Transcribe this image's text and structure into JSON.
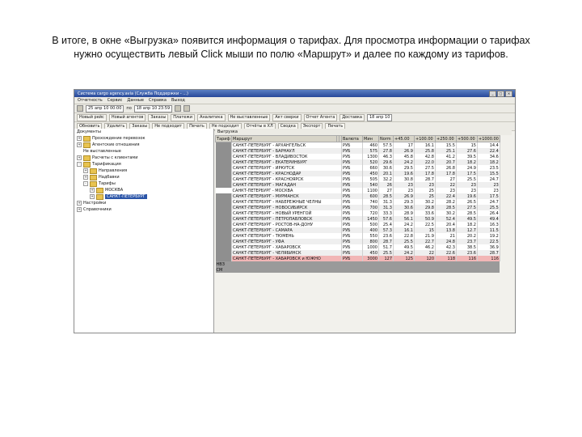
{
  "caption": {
    "line1": "В итоге, в окне «Выгрузка» появится информация о тарифах. Для просмотра информации о тарифах",
    "line2": "нужно осуществить левый Click мыши по полю «Маршрут» и далее по каждому из тарифов."
  },
  "window": {
    "title": "Система cargo agency.avia (Служба Поддержки - ...)",
    "minimize": "_",
    "maximize": "□",
    "close": "×"
  },
  "menu": [
    "Отчетность",
    "Сервис",
    "Данные",
    "Справка",
    "Выход"
  ],
  "toolbar1": {
    "date_from": "25 апр 10 00:00",
    "to_label": "по",
    "date_to": "18 апр 10 23:59"
  },
  "toolbar2": [
    "Новый рейс",
    "Новый агентов",
    "Заказы",
    "Платежи",
    "Аналитика",
    "Не выставленные",
    "Акт сверки",
    "Отчет Агента",
    "Доставка",
    "18 апр 10"
  ],
  "toolbar3": [
    "Обновить",
    "Удалить",
    "Заказы",
    "Не подходит",
    "Печать",
    "Не подходит",
    "Отчёты в ХЛ",
    "Сводка",
    "Экспорт",
    "Печать"
  ],
  "tree": {
    "items": [
      {
        "label": "Документы",
        "level": 0,
        "folder": false,
        "expander": ""
      },
      {
        "label": "Прохождение перевозок",
        "level": 0,
        "folder": true,
        "expander": "+"
      },
      {
        "label": "Агентские отношения",
        "level": 0,
        "folder": true,
        "expander": "+"
      },
      {
        "label": "Не выставленные",
        "level": 1,
        "folder": false,
        "expander": ""
      },
      {
        "label": "Расчеты с клиентами",
        "level": 0,
        "folder": true,
        "expander": "+"
      },
      {
        "label": "Тарификация",
        "level": 0,
        "folder": true,
        "expander": "-"
      },
      {
        "label": "Направления",
        "level": 1,
        "folder": true,
        "expander": "+"
      },
      {
        "label": "Надбавки",
        "level": 1,
        "folder": true,
        "expander": "+"
      },
      {
        "label": "Тарифы",
        "level": 1,
        "folder": true,
        "expander": "-"
      },
      {
        "label": "МОСКВА",
        "level": 2,
        "folder": true,
        "expander": "+"
      },
      {
        "label": "САНКТ-ПЕТЕРБУРГ",
        "level": 2,
        "folder": true,
        "expander": "+",
        "selected": true
      },
      {
        "label": "Настройки",
        "level": 0,
        "folder": false,
        "expander": "+"
      },
      {
        "label": "Справочники",
        "level": 0,
        "folder": false,
        "expander": "+"
      }
    ]
  },
  "grid": {
    "title": "Выгрузка",
    "columns": [
      "Тариф",
      "Маршрут",
      "",
      "",
      "Валюта",
      "Мин",
      "Norm",
      "+45.00",
      "+100.00",
      "+250.00",
      "+500.00",
      "+1000.00"
    ],
    "rowhead_label": "ВЭЯ",
    "rows": [
      [
        "САНКТ-ПЕТЕРБУРГ - АРХАНГЕЛЬСК",
        "РУБ",
        "460",
        "57.5",
        "17",
        "16.1",
        "15.5",
        "15",
        "14.4"
      ],
      [
        "САНКТ-ПЕТЕРБУРГ - БАРНАУЛ",
        "РУБ",
        "575",
        "27.8",
        "26.9",
        "25.8",
        "25.1",
        "27.6",
        "22.4"
      ],
      [
        "САНКТ-ПЕТЕРБУРГ - ВЛАДИВОСТОК",
        "РУБ",
        "1300",
        "46.3",
        "45.8",
        "42.8",
        "41.2",
        "39.5",
        "34.6"
      ],
      [
        "САНКТ-ПЕТЕРБУРГ - ЕКАТЕРИНБУРГ",
        "РУБ",
        "520",
        "29.6",
        "24.2",
        "22.0",
        "20.7",
        "18.2",
        "18.2"
      ],
      [
        "САНКТ-ПЕТЕРБУРГ - ИРКУТСК",
        "РУБ",
        "660",
        "30.6",
        "29.5",
        "27.5",
        "26.8",
        "24.9",
        "23.5"
      ],
      [
        "САНКТ-ПЕТЕРБУРГ - КРАСНОДАР",
        "РУБ",
        "450",
        "20.1",
        "19.6",
        "17.8",
        "17.8",
        "17.5",
        "15.5"
      ],
      [
        "САНКТ-ПЕТЕРБУРГ - КРАСНОЯРСК",
        "РУБ",
        "505",
        "32.2",
        "30.8",
        "28.7",
        "27",
        "25.5",
        "24.7"
      ],
      [
        "САНКТ-ПЕТЕРБУРГ - МАГАДАН",
        "РУБ",
        "540",
        "26",
        "23",
        "23",
        "22",
        "23",
        "23"
      ],
      [
        "САНКТ-ПЕТЕРБУРГ - МОСКВА",
        "РУБ",
        "1100",
        "27",
        "23",
        "25",
        "23",
        "23",
        "23"
      ],
      [
        "САНКТ-ПЕТЕРБУРГ - МУРМАНСК",
        "РУБ",
        "600",
        "28.5",
        "26.9",
        "25",
        "22.4",
        "19.6",
        "17.5"
      ],
      [
        "САНКТ-ПЕТЕРБУРГ - НАБЕРЕЖНЫЕ ЧЕЛНЫ",
        "РУБ",
        "740",
        "31.3",
        "29.3",
        "30.2",
        "28.2",
        "26.5",
        "24.7"
      ],
      [
        "САНКТ-ПЕТЕРБУРГ - НОВОСИБИРСК",
        "РУБ",
        "700",
        "31.3",
        "30.6",
        "29.8",
        "28.5",
        "27.5",
        "25.5"
      ],
      [
        "САНКТ-ПЕТЕРБУРГ - НОВЫЙ УРЕНГОЙ",
        "РУБ",
        "720",
        "33.3",
        "28.9",
        "33.6",
        "30.2",
        "28.5",
        "26.4"
      ],
      [
        "САНКТ-ПЕТЕРБУРГ - ПЕТРОПАВЛОВСК",
        "РУБ",
        "1450",
        "57.6",
        "56.1",
        "50.9",
        "52.4",
        "49.5",
        "49.4"
      ],
      [
        "САНКТ-ПЕТЕРБУРГ - РОСТОВ-НА-ДОНУ",
        "РУБ",
        "500",
        "25.4",
        "24.2",
        "22.5",
        "20.4",
        "18.2",
        "16.3"
      ],
      [
        "САНКТ-ПЕТЕРБУРГ - САМАРА",
        "РУБ",
        "400",
        "57.3",
        "16.1",
        "15",
        "13.8",
        "12.7",
        "11.5"
      ],
      [
        "САНКТ-ПЕТЕРБУРГ - ТЮМЕНЬ",
        "РУБ",
        "550",
        "23.6",
        "22.8",
        "21.9",
        "21",
        "20.2",
        "19.2"
      ],
      [
        "САНКТ-ПЕТЕРБУРГ - УФА",
        "РУБ",
        "800",
        "28.7",
        "25.5",
        "22.7",
        "24.8",
        "23.7",
        "22.5"
      ],
      [
        "САНКТ-ПЕТЕРБУРГ - ХАБАРОВСК",
        "РУБ",
        "1000",
        "51.7",
        "49.5",
        "46.2",
        "42.3",
        "38.5",
        "36.9"
      ],
      [
        "САНКТ-ПЕТЕРБУРГ - ЧЕЛЯБИНСК",
        "РУБ",
        "450",
        "25.5",
        "24.2",
        "22",
        "22.6",
        "23.6",
        "28.7"
      ],
      [
        "САНКТ-ПЕТЕРБУРГ - ХАБАРОВСК и ЮЖНО",
        "РУБ",
        "3000",
        "127",
        "125",
        "120",
        "118",
        "116",
        "116"
      ]
    ],
    "footer_labels": [
      "НВЗ",
      "СМ"
    ]
  }
}
